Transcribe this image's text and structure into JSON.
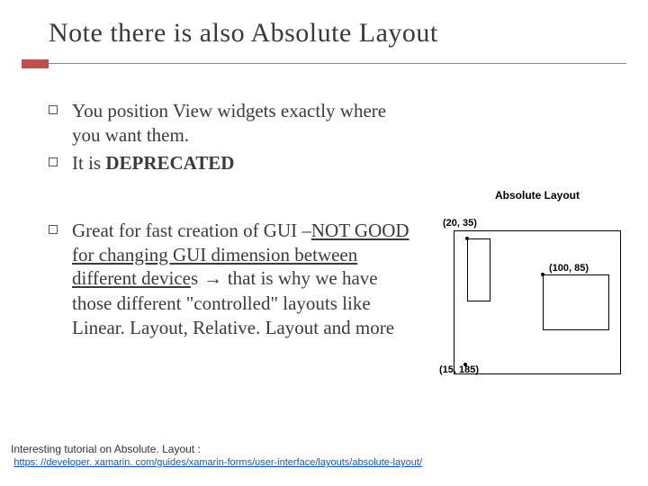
{
  "title": "Note there is also Absolute Layout",
  "bullets": {
    "b1": "You position View widgets exactly where you want them.",
    "b2_pre": "It is ",
    "b2_bold": "DEPRECATED",
    "b3_pre": "Great for fast creation of GUI –",
    "b3_under": "NOT GOOD for changing GUI dimension between different device",
    "b3_post_s": "s",
    "b3_arrow": " → ",
    "b3_rest": "that is why we have those different \"controlled\" layouts like Linear. Layout, Relative. Layout and more"
  },
  "diagram": {
    "title": "Absolute Layout",
    "coord1": "(20, 35)",
    "coord2": "(100, 85)",
    "coord3": "(15, 185)"
  },
  "footer": {
    "text": "Interesting tutorial on Absolute. Layout :",
    "link": "https: //developer. xamarin. com/guides/xamarin-forms/user-interface/layouts/absolute-layout/"
  }
}
